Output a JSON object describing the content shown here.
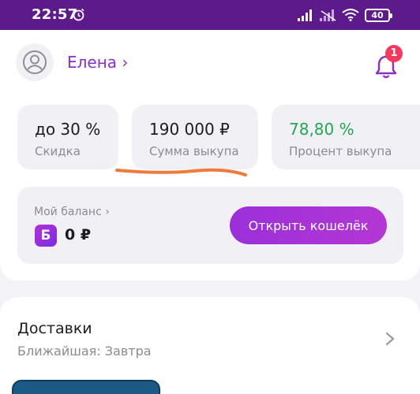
{
  "status_bar": {
    "time": "22:57",
    "battery": "40",
    "icons": [
      "alarm-icon",
      "signal-icon",
      "signal-off-icon",
      "wifi-icon",
      "battery-icon"
    ]
  },
  "profile": {
    "name": "Елена ›",
    "notifications_count": "1"
  },
  "stats": [
    {
      "value": "до 30 %",
      "label": "Скидка"
    },
    {
      "value": "190 000 ₽",
      "label": "Сумма выкупа"
    },
    {
      "value": "78,80 %",
      "label": "Процент выкупа"
    }
  ],
  "balance": {
    "title": "Мой баланс ›",
    "currency_icon_letter": "Б",
    "amount": "0 ₽",
    "wallet_button": "Открыть кошелёк"
  },
  "delivery": {
    "title": "Доставки",
    "subtitle": "Ближайшая: Завтра"
  },
  "colors": {
    "status_bar": "#5c1a8a",
    "accent": "#8b2fc9",
    "positive": "#22a752",
    "badge": "#f33a5c",
    "annotation": "#f07a3a"
  }
}
